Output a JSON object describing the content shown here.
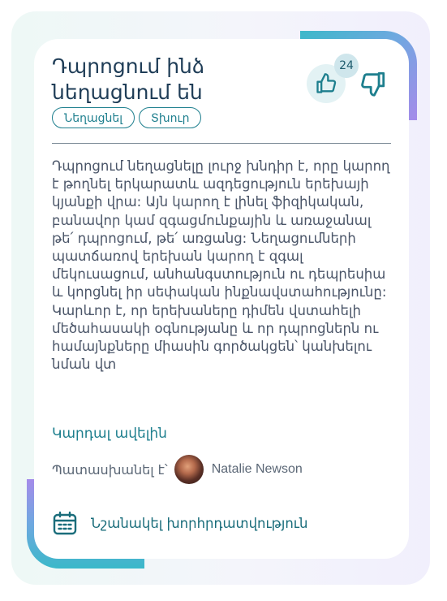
{
  "card": {
    "title": "Դպրոցում ինձ նեղացնում են",
    "tags": [
      "Նեղացնել",
      "Տխուր"
    ],
    "like_count": "24",
    "body": "Դպրոցում նեղացնելը լուրջ խնդիր է, որը կարող է թողնել երկարատև ազդեցություն երեխայի կյանքի վրա: Այն կարող է լինել ֆիզիկական, բանավոր կամ զգացմունքային և առաջանալ թե՛ դպրոցում, թե՛ առցանց: Նեղացումների պատճառով երեխան կարող է զգալ մեկուսացում, անհանգստություն ու դեպրեսիա և կորցնել իր սեփական ինքնավստահությունը: Կարևոր է, որ երեխաները դիմեն վստահելի մեծահասակի օգնությանը և որ դպրոցներն ու համայնքները միասին գործակցեն՝ կանխելու նման վտ",
    "read_more": "Կարդալ ավելին",
    "answered_by_label": "Պատասխանել է՝",
    "author_name": "Natalie Newson",
    "bookmark_label": "Նշանակել խորհրդատվություն"
  },
  "icons": {
    "like": "thumbs-up-icon",
    "dislike": "thumbs-down-icon",
    "calendar": "calendar-icon"
  },
  "colors": {
    "accent": "#1e7f8e",
    "title": "#1f3d57",
    "body_text": "#4a5568",
    "like_bg": "#e3f2f4"
  }
}
